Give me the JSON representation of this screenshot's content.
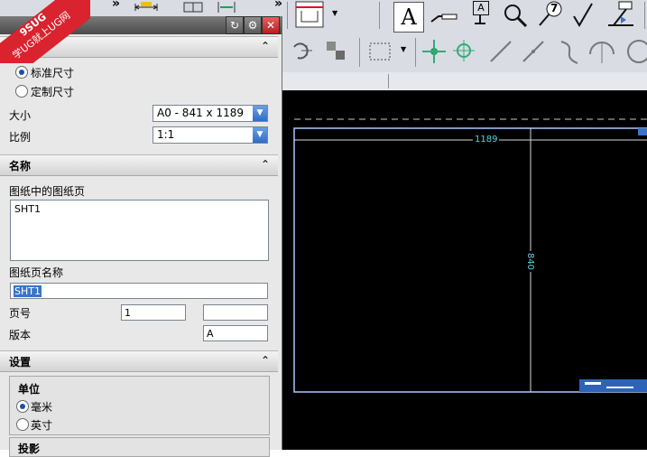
{
  "watermark": {
    "text1": "9SUG",
    "text2": "学UG就上UG网"
  },
  "toolbar": {
    "overflow_label": "»",
    "icons": [
      "drawing-sheet-icon",
      "text-annotation-icon",
      "datum-icon",
      "zoom-icon",
      "id-symbol-icon",
      "surface-finish-icon",
      "weld-symbol-icon"
    ],
    "text_icon_label": "A",
    "datum_label": "A",
    "id_symbol_label": "7",
    "zoom_label": ""
  },
  "dialog": {
    "sheet_size": {
      "standard_label": "标准尺寸",
      "custom_label": "定制尺寸",
      "size_label": "大小",
      "size_value": "A0 - 841 x 1189",
      "scale_label": "比例",
      "scale_value": "1:1"
    },
    "name_section": {
      "title": "名称",
      "sheets_label": "图纸中的图纸页",
      "sheets": [
        "SHT1"
      ],
      "sheet_name_label": "图纸页名称",
      "sheet_name_value": "SHT1",
      "page_number_label": "页号",
      "page_number_value": "1",
      "page_number_extra": "",
      "revision_label": "版本",
      "revision_value": "A"
    },
    "settings_section": {
      "title": "设置",
      "units_label": "单位",
      "mm_label": "毫米",
      "inch_label": "英寸",
      "projection_label": "投影"
    }
  },
  "canvas": {
    "width_dim": "1189",
    "height_dim": "840",
    "background": "#000000",
    "border_color": "#a9c8ff",
    "dim_color": "#5fd3e0"
  },
  "colors": {
    "accent": "#3a74c9",
    "watermark_red": "#d9232e"
  }
}
